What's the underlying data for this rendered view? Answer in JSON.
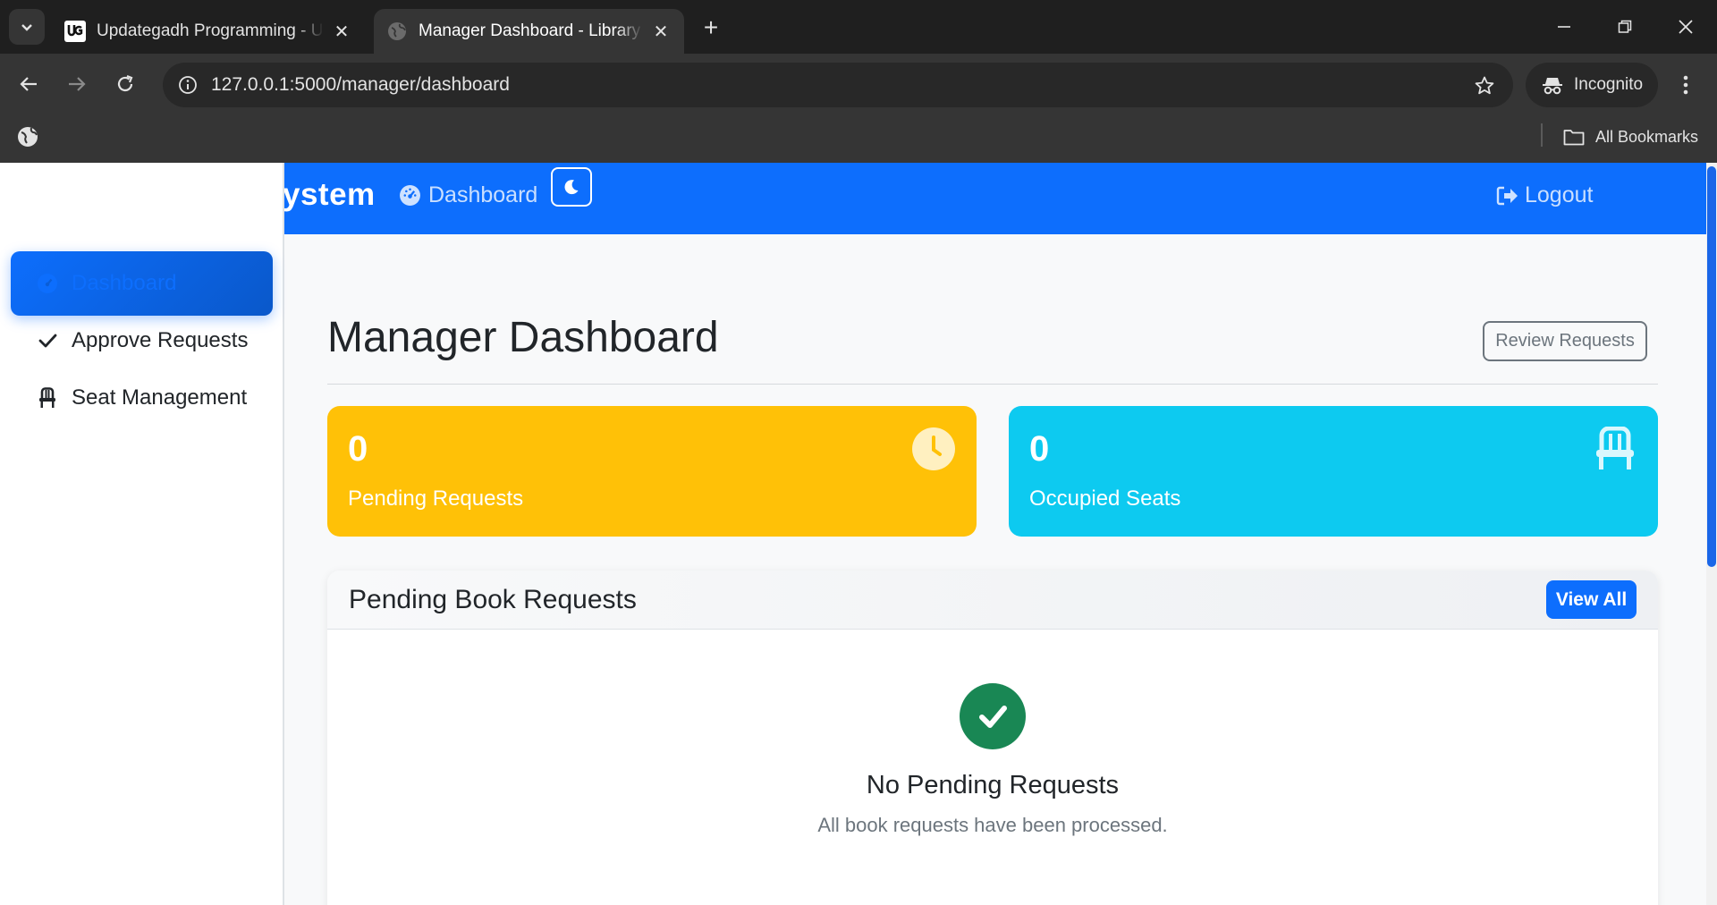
{
  "browser": {
    "tabs": [
      {
        "title": "Updategadh Programming - Updategadh",
        "favicon": "ug-logo-icon",
        "active": false
      },
      {
        "title": "Manager Dashboard - Library Management System",
        "favicon": "globe-icon",
        "active": true
      }
    ],
    "address": "127.0.0.1:5000/manager/dashboard",
    "incognito_label": "Incognito",
    "all_bookmarks_label": "All Bookmarks"
  },
  "navbar": {
    "brand": "ystem",
    "dashboard_link": "Dashboard",
    "logout_link": "Logout",
    "color": "#0d6efd"
  },
  "sidebar": {
    "items": [
      {
        "label": "Dashboard",
        "icon": "gauge-icon",
        "active": true
      },
      {
        "label": "Approve Requests",
        "icon": "check-icon",
        "active": false
      },
      {
        "label": "Seat Management",
        "icon": "chair-icon",
        "active": false
      }
    ]
  },
  "main": {
    "title": "Manager Dashboard",
    "review_button": "Review Requests",
    "stats": [
      {
        "value": "0",
        "label": "Pending Requests",
        "icon": "clock-icon",
        "color": "#ffc107"
      },
      {
        "value": "0",
        "label": "Occupied Seats",
        "icon": "chair-icon",
        "color": "#0dcaf0"
      }
    ],
    "panel": {
      "title": "Pending Book Requests",
      "view_all": "View All",
      "empty_title": "No Pending Requests",
      "empty_text": "All book requests have been processed.",
      "empty_icon": "check-circle-icon",
      "empty_color": "#198754"
    }
  }
}
